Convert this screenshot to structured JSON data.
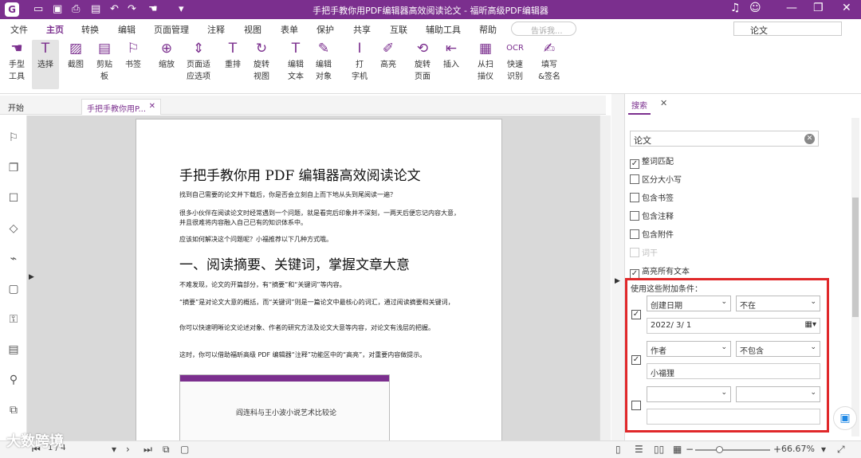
{
  "title": "手把手教你用PDF编辑器高效阅读论文 - 福昕高级PDF编辑器",
  "menu": [
    "文件",
    "主页",
    "转换",
    "编辑",
    "页面管理",
    "注释",
    "视图",
    "表单",
    "保护",
    "共享",
    "互联",
    "辅助工具",
    "帮助"
  ],
  "help_placeholder": "告诉我...",
  "search_value": "论文",
  "ribbon": [
    {
      "label": "手型\n工具"
    },
    {
      "label": "选择"
    },
    {
      "label": "截图"
    },
    {
      "label": "剪贴\n板"
    },
    {
      "label": "书签"
    },
    {
      "label": "缩放"
    },
    {
      "label": "页面适\n应选项"
    },
    {
      "label": "重排"
    },
    {
      "label": "旋转\n视图"
    },
    {
      "label": "编辑\n文本"
    },
    {
      "label": "编辑\n对象"
    },
    {
      "label": "打\n字机"
    },
    {
      "label": "高亮"
    },
    {
      "label": "旋转\n页面"
    },
    {
      "label": "插入"
    },
    {
      "label": "从扫\n描仪"
    },
    {
      "label": "快速\n识别"
    },
    {
      "label": "填写\n&签名"
    }
  ],
  "tabs": [
    "开始",
    "手把手教你用P..."
  ],
  "page": {
    "h1": "手把手教你用 PDF 编辑器高效阅读论文",
    "p1": "找到自己需要的论文并下载后，你是否会立刻自上而下地从头到尾阅读一遍？",
    "p2": "很多小伙伴在阅读论文时经常遇到一个问题，就是看完后印象并不深刻，一两天后便忘记内容大意，并且很难将内容融入自己已有的知识体系中。",
    "p3": "应该如何解决这个问题呢？小福推荐以下几种方式哦。",
    "h2": "一、阅读摘要、关键词，掌握文章大意",
    "p4": "不难发现，论文的开篇部分，有“摘要”和“关键词”等内容。",
    "p5": "“摘要”是对论文大意的概括，而“关键词”则是一篇论文中最核心的词汇，通过阅读摘要和关键词，",
    "p6": "你可以快速明晰论文论述对象、作者的研究方法及论文大意等内容，对论文有浅层的把握。",
    "p7": "这时，你可以借助福昕高级 PDF 编辑器“注释”功能区中的“高亮”，对重要内容做提示。",
    "thumb_title": "阎连科与王小波小说艺术比较论"
  },
  "panel": {
    "tab": "搜索",
    "query": "论文",
    "options": [
      {
        "label": "整词匹配",
        "checked": true,
        "disabled": false
      },
      {
        "label": "区分大小写",
        "checked": false,
        "disabled": false
      },
      {
        "label": "包含书签",
        "checked": false,
        "disabled": false
      },
      {
        "label": "包含注释",
        "checked": false,
        "disabled": false
      },
      {
        "label": "包含附件",
        "checked": false,
        "disabled": false
      },
      {
        "label": "词干",
        "checked": false,
        "disabled": true
      },
      {
        "label": "高亮所有文本",
        "checked": true,
        "disabled": false
      }
    ],
    "cond_label": "使用这些附加条件：",
    "c1_field": "创建日期",
    "c1_op": "不在",
    "c1_value": "2022/ 3/ 1",
    "c2_field": "作者",
    "c2_op": "不包含",
    "c2_value": "小福狸"
  },
  "status": {
    "page": "1 / 4",
    "zoom": "66.67%"
  },
  "watermark": "大数跨境",
  "accent": "#7b2f8e"
}
